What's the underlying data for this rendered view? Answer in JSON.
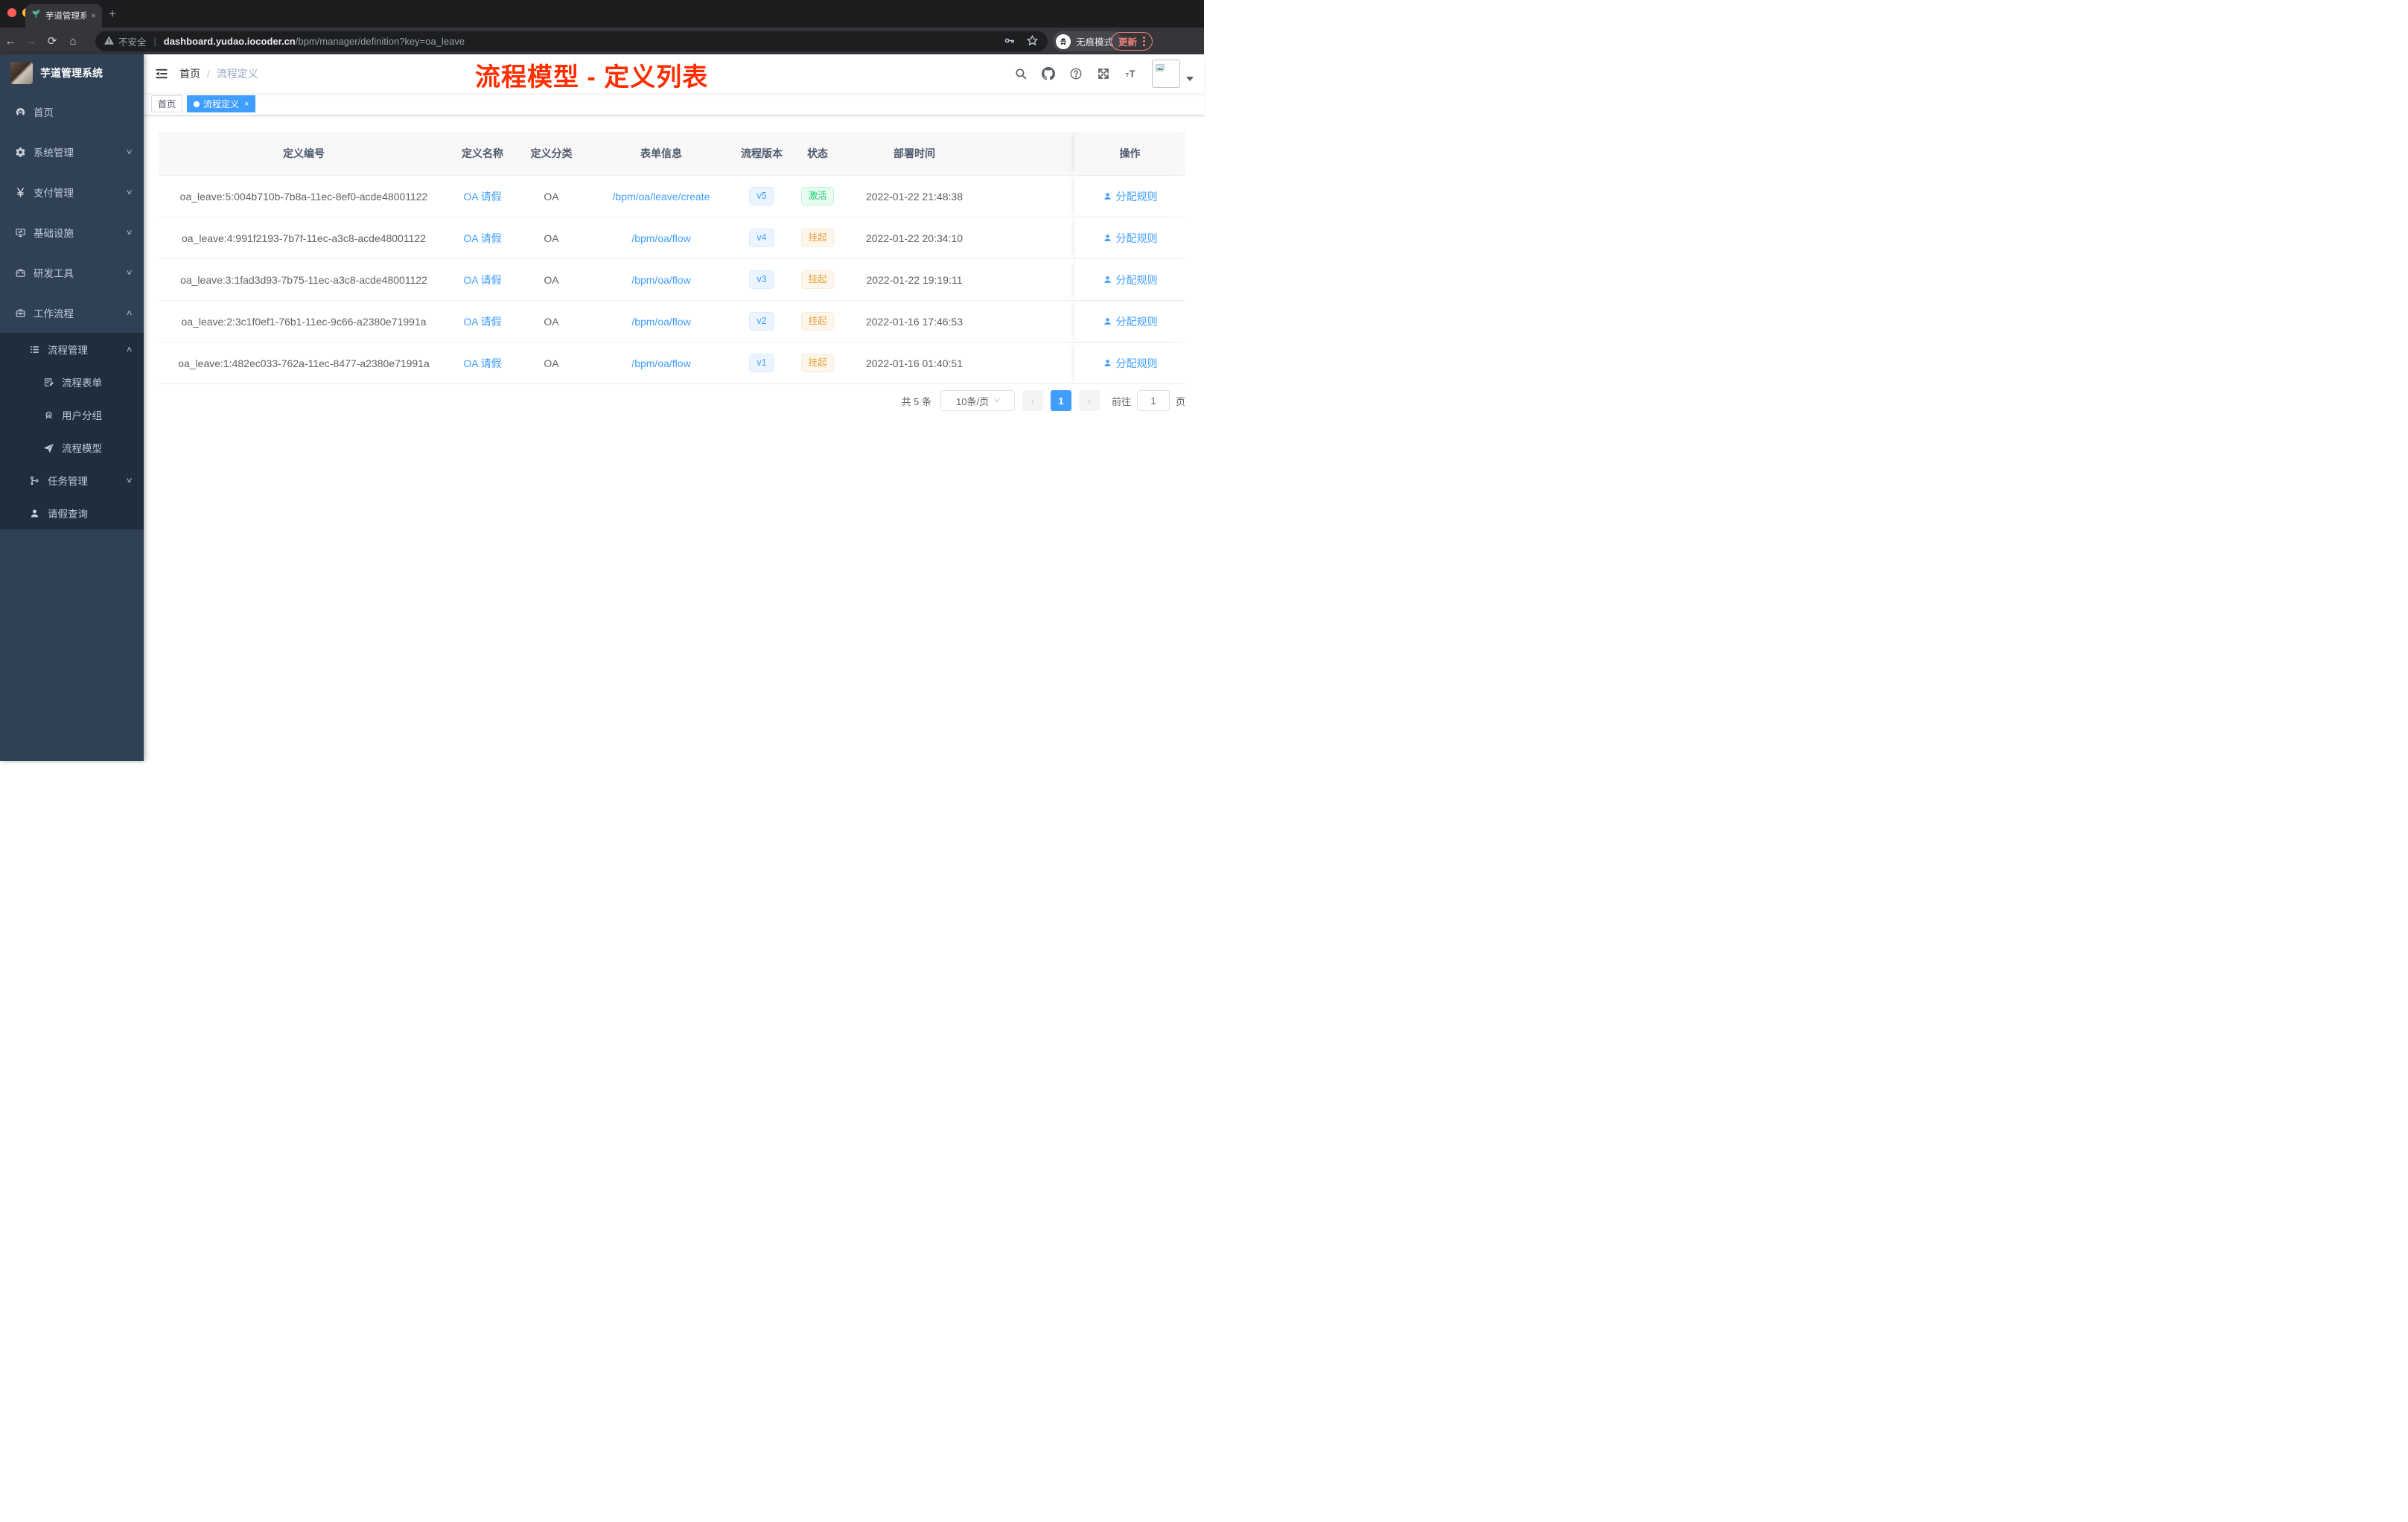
{
  "browser": {
    "tab_title": "芋道管理系统",
    "tab_close": "×",
    "new_tab": "+",
    "security_label": "不安全",
    "url_domain": "dashboard.yudao.iocoder.cn",
    "url_path": "/bpm/manager/definition?key=oa_leave",
    "incognito_label": "无痕模式",
    "update_label": "更新"
  },
  "sidebar": {
    "title": "芋道管理系统",
    "items": [
      {
        "label": "首页",
        "icon": "dashboard-icon",
        "level": 1,
        "chevron": "",
        "dark": false
      },
      {
        "label": "系统管理",
        "icon": "gear-icon",
        "level": 1,
        "chevron": "down",
        "dark": false
      },
      {
        "label": "支付管理",
        "icon": "yen-icon",
        "level": 1,
        "chevron": "down",
        "dark": false
      },
      {
        "label": "基础设施",
        "icon": "monitor-icon",
        "level": 1,
        "chevron": "down",
        "dark": false
      },
      {
        "label": "研发工具",
        "icon": "toolbox-icon",
        "level": 1,
        "chevron": "down",
        "dark": false
      },
      {
        "label": "工作流程",
        "icon": "briefcase-icon",
        "level": 1,
        "chevron": "up",
        "dark": false
      },
      {
        "label": "流程管理",
        "icon": "list-icon",
        "level": 2,
        "chevron": "up",
        "dark": true
      },
      {
        "label": "流程表单",
        "icon": "form-icon",
        "level": 3,
        "chevron": "",
        "dark": true
      },
      {
        "label": "用户分组",
        "icon": "group-icon",
        "level": 3,
        "chevron": "",
        "dark": true
      },
      {
        "label": "流程模型",
        "icon": "send-icon",
        "level": 3,
        "chevron": "",
        "dark": true
      },
      {
        "label": "任务管理",
        "icon": "tree-icon",
        "level": 2,
        "chevron": "down",
        "dark": true
      },
      {
        "label": "请假查询",
        "icon": "user-icon",
        "level": 2,
        "chevron": "",
        "dark": true
      }
    ]
  },
  "navbar": {
    "breadcrumb_home": "首页",
    "breadcrumb_sep": "/",
    "breadcrumb_current": "流程定义"
  },
  "annotation": "流程模型 - 定义列表",
  "tags": [
    {
      "label": "首页",
      "active": false
    },
    {
      "label": "流程定义",
      "active": true,
      "close": "×"
    }
  ],
  "table": {
    "headers": [
      "定义编号",
      "定义名称",
      "定义分类",
      "表单信息",
      "流程版本",
      "状态",
      "部署时间",
      "操作"
    ],
    "action_label": "分配规则",
    "rows": [
      {
        "id": "oa_leave:5:004b710b-7b8a-11ec-8ef0-acde48001122",
        "name": "OA 请假",
        "category": "OA",
        "form": "/bpm/oa/leave/create",
        "version": "v5",
        "status": "激活",
        "status_type": "active",
        "deploy_time": "2022-01-22 21:48:38",
        "action": "分配规则"
      },
      {
        "id": "oa_leave:4:991f2193-7b7f-11ec-a3c8-acde48001122",
        "name": "OA 请假",
        "category": "OA",
        "form": "/bpm/oa/flow",
        "version": "v4",
        "status": "挂起",
        "status_type": "suspended",
        "deploy_time": "2022-01-22 20:34:10",
        "action": "分配规则"
      },
      {
        "id": "oa_leave:3:1fad3d93-7b75-11ec-a3c8-acde48001122",
        "name": "OA 请假",
        "category": "OA",
        "form": "/bpm/oa/flow",
        "version": "v3",
        "status": "挂起",
        "status_type": "suspended",
        "deploy_time": "2022-01-22 19:19:11",
        "action": "分配规则"
      },
      {
        "id": "oa_leave:2:3c1f0ef1-76b1-11ec-9c66-a2380e71991a",
        "name": "OA 请假",
        "category": "OA",
        "form": "/bpm/oa/flow",
        "version": "v2",
        "status": "挂起",
        "status_type": "suspended",
        "deploy_time": "2022-01-16 17:46:53",
        "action": "分配规则"
      },
      {
        "id": "oa_leave:1:482ec033-762a-11ec-8477-a2380e71991a",
        "name": "OA 请假",
        "category": "OA",
        "form": "/bpm/oa/flow",
        "version": "v1",
        "status": "挂起",
        "status_type": "suspended",
        "deploy_time": "2022-01-16 01:40:51",
        "action": "分配规则"
      }
    ]
  },
  "pagination": {
    "total": "共 5 条",
    "page_size": "10条/页",
    "prev": "‹",
    "current": "1",
    "next": "›",
    "goto_label": "前往",
    "goto_value": "1",
    "goto_suffix": "页"
  }
}
